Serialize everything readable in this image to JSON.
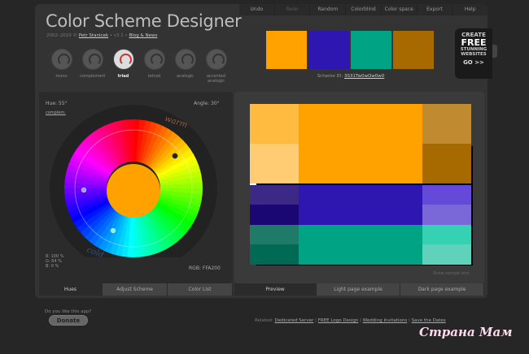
{
  "app": {
    "title": "Color Scheme Designer",
    "subtitle_prefix": "2002–2010 © ",
    "author": "Petr Stanicek",
    "version": " • v3.1 • ",
    "blog": "Blog & News"
  },
  "menu": [
    {
      "label": "Undo",
      "enabled": true
    },
    {
      "label": "Redo",
      "enabled": false
    },
    {
      "label": "Random",
      "enabled": true
    },
    {
      "label": "Colorblind",
      "enabled": true
    },
    {
      "label": "Color space",
      "enabled": true
    },
    {
      "label": "Export",
      "enabled": true
    },
    {
      "label": "Help",
      "enabled": true
    }
  ],
  "scheme_types": [
    {
      "label": "mono",
      "active": false
    },
    {
      "label": "complement",
      "active": false
    },
    {
      "label": "triad",
      "active": true
    },
    {
      "label": "tetrad",
      "active": false
    },
    {
      "label": "analogic",
      "active": false
    },
    {
      "label": "accented analogic",
      "active": false
    }
  ],
  "swatches": [
    "#FFA200",
    "#2E16B1",
    "#00A383",
    "#A66A00"
  ],
  "scheme_id": {
    "label": "Scheme ID: ",
    "value": "3S31Tw0wOw0w0"
  },
  "ad": {
    "line1": "CREATE",
    "line2": "FREE",
    "line3": "STUNNING",
    "line4": "WEBSITES",
    "cta": "GO >>"
  },
  "wheel": {
    "hue_label": "Hue: 55°",
    "complement_link": "complem.",
    "angle_label": "Angle: 30°",
    "warm": "warm",
    "cold": "cold",
    "center_color": "#FFA200",
    "rgb_lines": [
      "R: 100 %",
      "G:   64 %",
      "B:     0 %"
    ],
    "rgb_hex": "RGB: FFA200"
  },
  "left_tabs": [
    {
      "label": "Hues",
      "active": true
    },
    {
      "label": "Adjust Scheme",
      "active": false
    },
    {
      "label": "Color List",
      "active": false
    }
  ],
  "right_tabs": [
    {
      "label": "Preview",
      "active": true
    },
    {
      "label": "Light page example",
      "active": false
    },
    {
      "label": "Dark page example",
      "active": false
    }
  ],
  "show_sample_text": "Show sample text",
  "preview_colors": {
    "orange": [
      "#FFA200",
      "#FFBA40",
      "#FFCB73",
      "#BF8A30",
      "#A66A00"
    ],
    "blue": [
      "#2E16B1",
      "#3B2985",
      "#1B0773",
      "#6549D8",
      "#7B68D8"
    ],
    "green": [
      "#00A383",
      "#1F7A68",
      "#006A55",
      "#36D1B2",
      "#60D1BB"
    ]
  },
  "footer": {
    "like_text": "Do you like this app?",
    "donate": "Donate",
    "related_label": "Related: ",
    "links": [
      "Dedicated Server",
      "FREE Logo Design",
      "Wedding Invitations",
      "Save the Dates"
    ]
  },
  "watermark": "Страна Мам"
}
